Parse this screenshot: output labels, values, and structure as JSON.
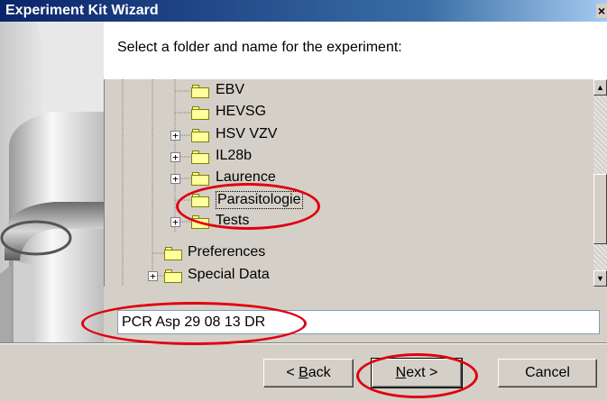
{
  "window": {
    "title": "Experiment Kit Wizard",
    "close_glyph": "×"
  },
  "header": {
    "instruction": "Select a folder and name for the experiment:"
  },
  "tree": {
    "items": [
      {
        "label": "EBV",
        "expandable": false
      },
      {
        "label": "HEVSG",
        "expandable": false
      },
      {
        "label": "HSV VZV",
        "expandable": true
      },
      {
        "label": "IL28b",
        "expandable": true
      },
      {
        "label": "Laurence",
        "expandable": true
      },
      {
        "label": "Parasitologie",
        "expandable": false,
        "selected": true
      },
      {
        "label": "Tests",
        "expandable": true
      },
      {
        "label": "Preferences",
        "expandable": false
      },
      {
        "label": "Special Data",
        "expandable": true
      }
    ],
    "expander_glyph": "+"
  },
  "scrollbar": {
    "up_glyph": "▲",
    "down_glyph": "▼"
  },
  "name_field": {
    "value": "PCR Asp 29 08 13 DR"
  },
  "buttons": {
    "back_prefix": "< ",
    "back_mnemonic": "B",
    "back_rest": "ack",
    "next_mnemonic": "N",
    "next_rest": "ext >",
    "cancel": "Cancel"
  },
  "annotation_color": "#e00010"
}
